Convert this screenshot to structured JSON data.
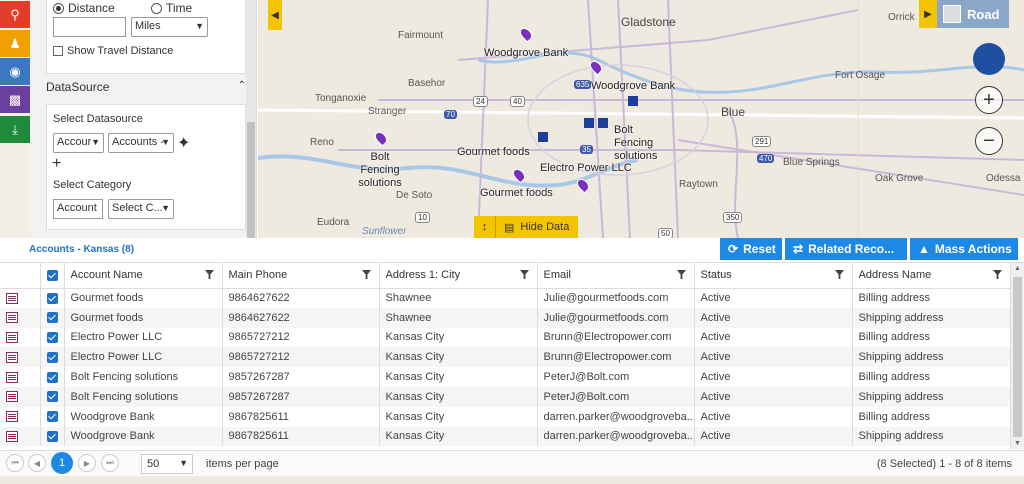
{
  "toolbar": {
    "icons": [
      "route-icon",
      "people-icon",
      "territory-icon",
      "map-usa-icon",
      "download-icon"
    ]
  },
  "panel": {
    "distance_label": "Distance",
    "time_label": "Time",
    "distance_value": "",
    "unit": "Miles",
    "show_travel_distance": "Show Travel Distance",
    "datasource_header": "DataSource",
    "select_datasource": "Select Datasource",
    "ds_entity": "Accour",
    "ds_view": "Accounts -",
    "select_category": "Select Category",
    "category_entity": "Account",
    "category_value": "Select C..."
  },
  "map": {
    "labels": [
      "Fairmount",
      "Gladstone",
      "Orrick",
      "Basehor",
      "Tonganoxie",
      "Stranger",
      "Reno",
      "De Soto",
      "Eudora",
      "Sunflower",
      "Blue",
      "Blue Springs",
      "Fort Osage",
      "Oak Grove",
      "Odessa",
      "Raytown"
    ],
    "pois": [
      "Woodgrove Bank",
      "Woodgrove Bank",
      "Bolt Fencing solutions",
      "Bolt Fencing solutions",
      "Gourmet foods",
      "Gourmet foods",
      "Electro Power LLC"
    ],
    "shields": [
      "24",
      "40",
      "635",
      "70",
      "35",
      "291",
      "470",
      "350",
      "10",
      "50"
    ],
    "road_label": "Road",
    "hide_data_label": "Hide Data"
  },
  "grid": {
    "title": "Accounts - Kansas (8)",
    "reset_label": "Reset",
    "related_label": "Related Reco...",
    "mass_actions_label": "Mass Actions",
    "columns": [
      "Account Name",
      "Main Phone",
      "Address 1: City",
      "Email",
      "Status",
      "Address Name"
    ],
    "rows": [
      [
        "Gourmet foods",
        "9864627622",
        "Shawnee",
        "Julie@gourmetfoods.com",
        "Active",
        "Billing address"
      ],
      [
        "Gourmet foods",
        "9864627622",
        "Shawnee",
        "Julie@gourmetfoods.com",
        "Active",
        "Shipping address"
      ],
      [
        "Electro Power LLC",
        "9865727212",
        "Kansas City",
        "Brunn@Electropower.com",
        "Active",
        "Billing address"
      ],
      [
        "Electro Power LLC",
        "9865727212",
        "Kansas City",
        "Brunn@Electropower.com",
        "Active",
        "Shipping address"
      ],
      [
        "Bolt Fencing solutions",
        "9857267287",
        "Kansas City",
        "PeterJ@Bolt.com",
        "Active",
        "Billing address"
      ],
      [
        "Bolt Fencing solutions",
        "9857267287",
        "Kansas City",
        "PeterJ@Bolt.com",
        "Active",
        "Shipping address"
      ],
      [
        "Woodgrove Bank",
        "9867825611",
        "Kansas City",
        "darren.parker@woodgroveba...",
        "Active",
        "Billing address"
      ],
      [
        "Woodgrove Bank",
        "9867825611",
        "Kansas City",
        "darren.parker@woodgroveba...",
        "Active",
        "Shipping address"
      ]
    ]
  },
  "pager": {
    "current_page": "1",
    "page_size": "50",
    "items_per_page": "items per page",
    "info": "(8 Selected) 1 - 8 of 8 items"
  },
  "colors": {
    "accent": "#1e88e5",
    "yellow": "#f5c400",
    "pin": "#7b2fbe"
  }
}
